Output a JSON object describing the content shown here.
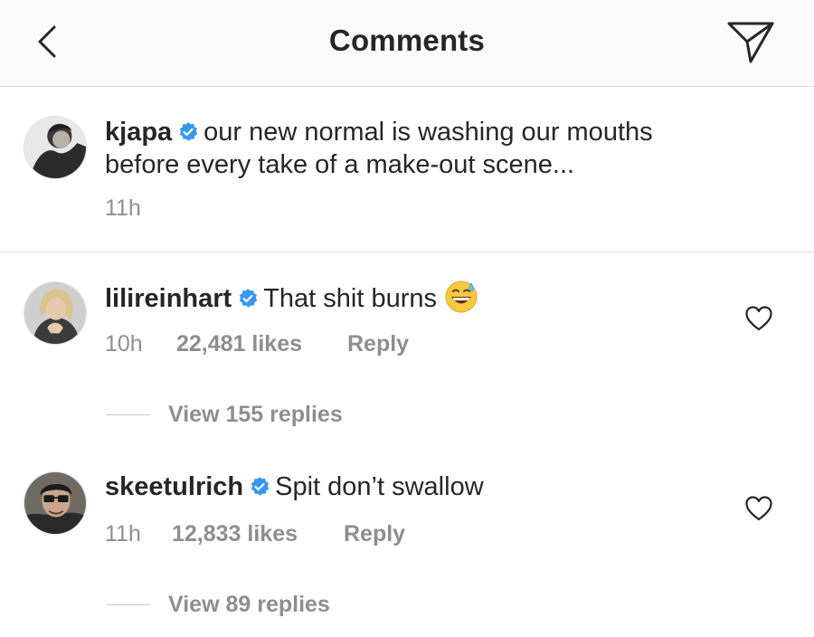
{
  "header": {
    "title": "Comments",
    "back_icon": "chevron-left-icon",
    "send_icon": "paper-plane-icon"
  },
  "caption": {
    "username": "kjapa",
    "text_line1": "our new normal is washing our mouths",
    "text_line2": "before every take of a make-out scene...",
    "time": "11h"
  },
  "comments": [
    {
      "username": "lilireinhart",
      "text": "That shit burns",
      "emoji": "grinning-face-with-sweat",
      "time": "10h",
      "likes": "22,481 likes",
      "reply_label": "Reply",
      "view_replies": "View 155 replies"
    },
    {
      "username": "skeetulrich",
      "text": "Spit don’t swallow",
      "time": "11h",
      "likes": "12,833 likes",
      "reply_label": "Reply",
      "view_replies": "View 89 replies"
    }
  ],
  "colors": {
    "text": "#262626",
    "secondary": "#8e8e8e",
    "verified": "#3897f0",
    "header_bg": "#fafafa"
  }
}
